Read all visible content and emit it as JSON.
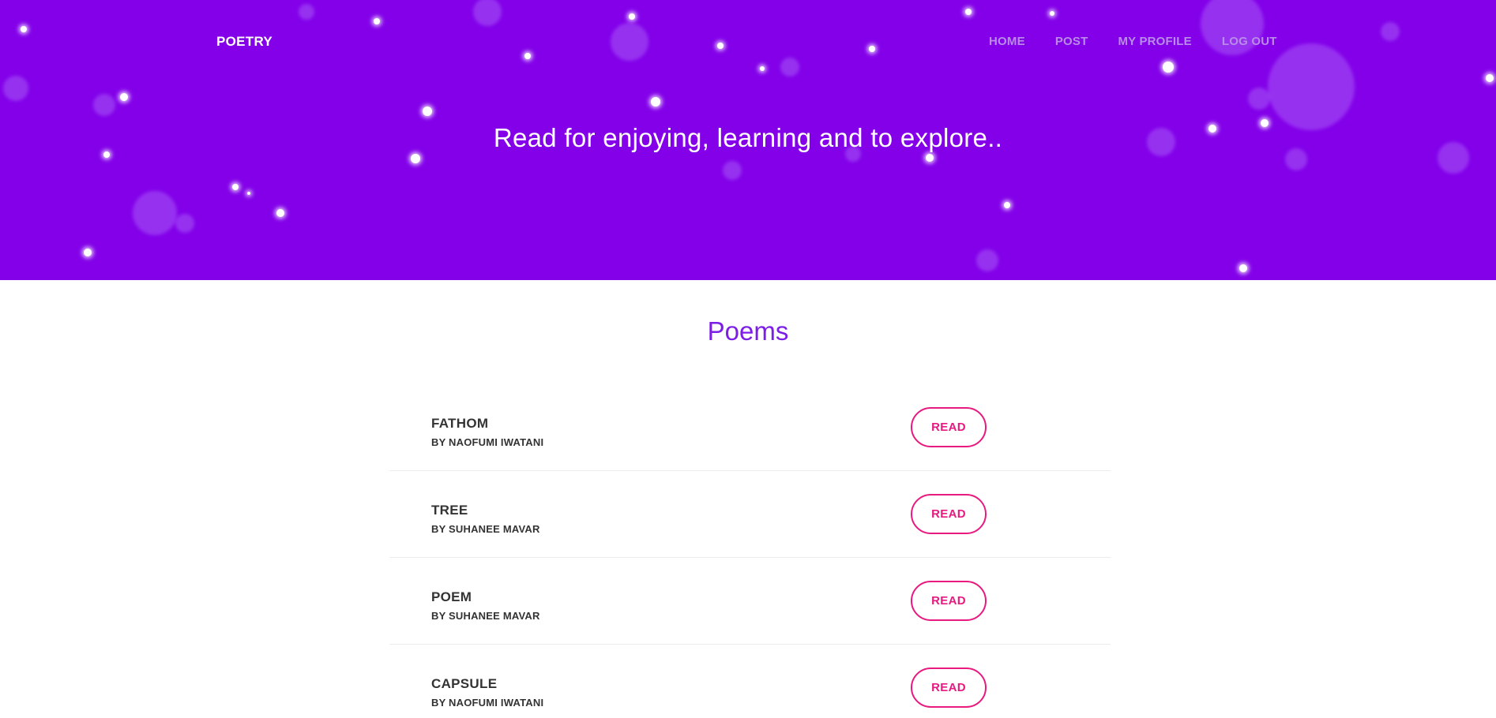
{
  "header": {
    "brand": "POETRY",
    "nav": [
      {
        "label": "HOME"
      },
      {
        "label": "POST"
      },
      {
        "label": "MY PROFILE"
      },
      {
        "label": "LOG OUT"
      }
    ]
  },
  "hero": {
    "tagline": "Read for enjoying, learning and to explore.."
  },
  "main": {
    "title": "Poems",
    "poems": [
      {
        "title": "FATHOM",
        "author": "BY NAOFUMI IWATANI",
        "button": "READ"
      },
      {
        "title": "TREE",
        "author": "BY SUHANEE MAVAR",
        "button": "READ"
      },
      {
        "title": "POEM",
        "author": "BY SUHANEE MAVAR",
        "button": "READ"
      },
      {
        "title": "CAPSULE",
        "author": "BY NAOFUMI IWATANI",
        "button": "READ"
      }
    ]
  },
  "colors": {
    "hero_background": "#8300e9",
    "accent_pink": "#e8197f",
    "title_purple": "#7b1ee6",
    "nav_text": "#b98ce8"
  }
}
